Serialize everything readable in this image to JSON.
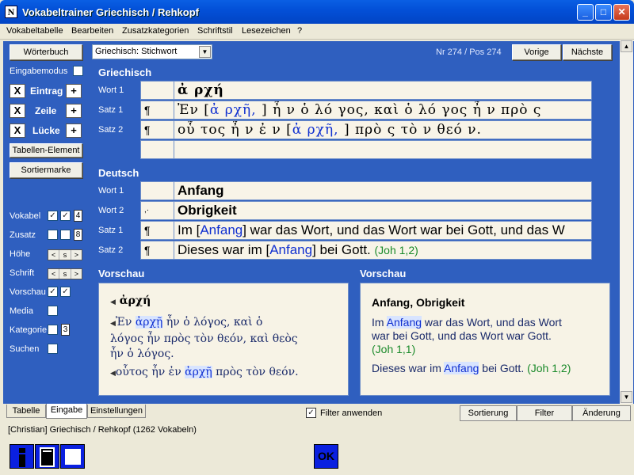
{
  "window": {
    "title": "Vokabeltrainer Griechisch / Rehkopf"
  },
  "menu": [
    "Vokabeltabelle",
    "Bearbeiten",
    "Zusatzkategorien",
    "Schriftstil",
    "Lesezeichen",
    "?"
  ],
  "sidebar": {
    "woerterbuch": "Wörterbuch",
    "eingabemodus": "Eingabemodus",
    "eintrag": "Eintrag",
    "zeile": "Zeile",
    "luecke": "Lücke",
    "tabellen_element": "Tabellen-Element",
    "sortiermarke": "Sortiermarke",
    "x": "X",
    "plus": "+",
    "vokabel": "Vokabel",
    "vokabel_count": "4",
    "zusatz": "Zusatz",
    "zusatz_count": "8",
    "hoehe": "Höhe",
    "schrift": "Schrift",
    "vorschau": "Vorschau",
    "media": "Media",
    "kategorie": "Kategorie",
    "kategorie_count": "3",
    "suchen": "Suchen",
    "small_btns": [
      "<",
      "s",
      ">"
    ]
  },
  "header": {
    "dropdown": "Griechisch: Stichwort",
    "nr": "Nr 274",
    "sep": "/",
    "pos": "Pos 274",
    "vorige": "Vorige",
    "naechste": "Nächste"
  },
  "griechisch": {
    "title": "Griechisch",
    "rows": [
      {
        "label": "Wort 1",
        "mark": "",
        "text": "ἀ ρχή"
      },
      {
        "label": "Satz 1",
        "mark": "¶",
        "pre": "Ἐν [",
        "hl": "ἀ ρχῆ, ",
        "post": " ] ἦ ν ὁ  λό γος, καὶ  ὁ  λό γος ἦ ν πρὸ ς"
      },
      {
        "label": "Satz 2",
        "mark": "¶",
        "pre": "οὗ τος ἦ ν ἐ ν [",
        "hl": "ἀ ρχῆ, ",
        "post": " ] πρὸ ς τὸ ν θεό ν."
      },
      {
        "label": "",
        "mark": "",
        "text": ""
      }
    ]
  },
  "deutsch": {
    "title": "Deutsch",
    "rows": [
      {
        "label": "Wort 1",
        "mark": "",
        "text": "Anfang"
      },
      {
        "label": "Wort 2",
        "mark": ",·",
        "text": "Obrigkeit"
      },
      {
        "label": "Satz 1",
        "mark": "¶",
        "pre": "Im [",
        "hl": "Anfang",
        "post": "] war das Wort, und das Wort war bei Gott, und das W"
      },
      {
        "label": "Satz 2",
        "mark": "¶",
        "pre": "Dieses war im [",
        "hl": "Anfang",
        "post": "] bei Gott. ",
        "ref": "(Joh 1,2)"
      }
    ]
  },
  "vorschau_left": {
    "title": "Vorschau",
    "word": "ἀρχή",
    "s1_pre": "Ἐν ",
    "s1_hl": "ἀρχῇ",
    "s1_post": " ἦν ὁ λόγος, καὶ ὁ",
    "s1_line2": "λόγος ἦν πρὸς τὸν θεόν, καὶ θεὸς",
    "s1_line3": "ἦν ὁ λόγος.",
    "s2_pre": "οὗτος ἦν ἐν ",
    "s2_hl": "ἀρχῇ",
    "s2_post": " πρὸς τὸν θεόν."
  },
  "vorschau_right": {
    "title": "Vorschau",
    "heading": "Anfang, Obrigkeit",
    "p1_pre": "Im ",
    "p1_hl": "Anfang",
    "p1_post": " war das Wort, und das Wort",
    "p1_line2": "war bei Gott, und das Wort war Gott.",
    "p1_ref": "(Joh 1,1)",
    "p2_pre": "Dieses war im ",
    "p2_hl": "Anfang",
    "p2_post": " bei Gott. ",
    "p2_ref": "(Joh 1,2)"
  },
  "bottom": {
    "tabs": [
      "Tabelle",
      "Eingabe",
      "Einstellungen"
    ],
    "filter": "Filter anwenden",
    "sortierung": "Sortierung",
    "filterbtn": "Filter",
    "aenderung": "Änderung"
  },
  "status": {
    "user": "[Christian]",
    "file": "Griechisch / Rehkopf",
    "count": "(1262 Vokabeln)"
  },
  "toolbar": {
    "ok": "OK"
  }
}
